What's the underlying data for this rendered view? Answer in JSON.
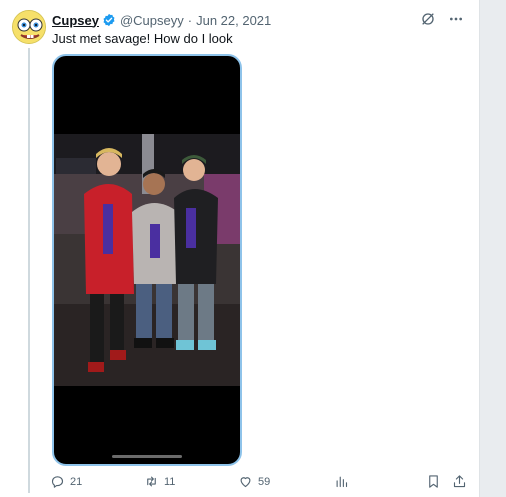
{
  "tweet": {
    "display_name": "Cupsey",
    "handle": "@Cupseyy",
    "separator": "·",
    "date": "Jun 22, 2021",
    "text": "Just met savage! How do I look"
  },
  "header_icons": [
    "grok-icon",
    "more-icon"
  ],
  "actions": {
    "replies": "21",
    "retweets": "11",
    "likes": "59"
  },
  "colors": {
    "verified": "#1d9bf0",
    "text_primary": "#0f1419",
    "text_secondary": "#536471",
    "media_border": "#8ec3ea",
    "thread_line": "#cfd9de"
  }
}
